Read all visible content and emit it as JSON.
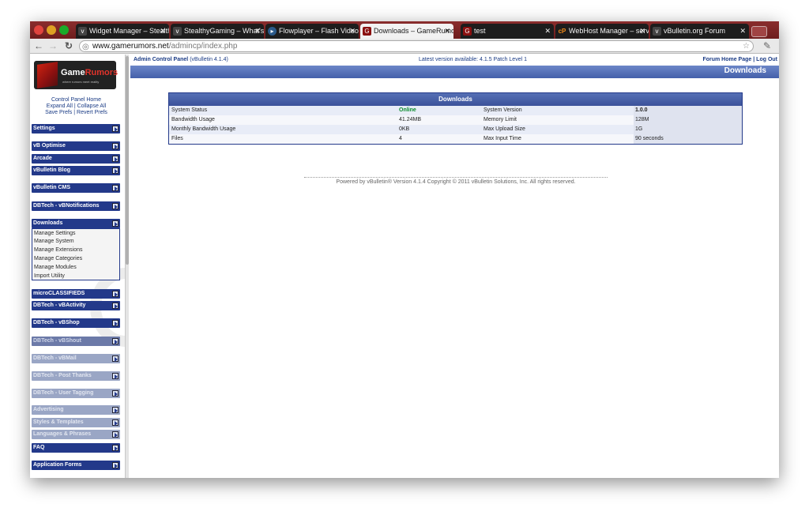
{
  "browser": {
    "tabs": [
      {
        "label": "Widget Manager – Stealth"
      },
      {
        "label": "StealthyGaming – What's"
      },
      {
        "label": "Flowplayer – Flash Video"
      },
      {
        "label": "Downloads – GameRumo"
      },
      {
        "label": "test"
      },
      {
        "label": "WebHost Manager – serv"
      },
      {
        "label": "vBulletin.org Forum"
      }
    ],
    "url_host": "www.gamerumors.net",
    "url_path": "/admincp/index.php"
  },
  "sidebar": {
    "logo_left": "Game",
    "logo_right": "Rumors",
    "logo_tagline": "where rumors meet reality",
    "cp_home": "Control Panel Home",
    "expand_all": "Expand All",
    "collapse_all": "Collapse All",
    "save_prefs": "Save Prefs",
    "revert_prefs": "Revert Prefs",
    "groups": [
      {
        "label": "Settings"
      },
      {
        "label": "vB Optimise"
      },
      {
        "label": "Arcade"
      },
      {
        "label": "vBulletin Blog"
      },
      {
        "label": "vBulletin CMS"
      },
      {
        "label": "DBTech - vBNotifications"
      },
      {
        "label": "Downloads"
      },
      {
        "label": "microCLASSIFIEDS"
      },
      {
        "label": "DBTech - vBActivity"
      },
      {
        "label": "DBTech - vBShop"
      },
      {
        "label": "DBTech - vBShout"
      },
      {
        "label": "DBTech - vBMail"
      },
      {
        "label": "DBTech - Post Thanks"
      },
      {
        "label": "DBTech - User Tagging"
      },
      {
        "label": "Advertising"
      },
      {
        "label": "Styles & Templates"
      },
      {
        "label": "Languages & Phrases"
      },
      {
        "label": "FAQ"
      },
      {
        "label": "Application Forms"
      }
    ],
    "downloads_items": [
      "Manage Settings",
      "Manage System",
      "Manage Extensions",
      "Manage Categories",
      "Manage Modules",
      "Import Utility"
    ]
  },
  "header": {
    "acp_label": "Admin Control Panel",
    "acp_version": "(vBulletin 4.1.4)",
    "latest_version": "Latest version available: 4.1.5 Patch Level 1",
    "forum_home": "Forum Home Page",
    "separator": "|",
    "log_out": "Log Out",
    "page_title": "Downloads"
  },
  "downloads_table": {
    "title": "Downloads",
    "rows": [
      {
        "k1": "System Status",
        "v1": "Online",
        "k2": "System Version",
        "v2": "1.0.0"
      },
      {
        "k1": "Bandwidth Usage",
        "v1": "41.24MB",
        "k2": "Memory Limit",
        "v2": "128M"
      },
      {
        "k1": "Monthly Bandwidth Usage",
        "v1": "0KB",
        "k2": "Max Upload Size",
        "v2": "1G"
      },
      {
        "k1": "Files",
        "v1": "4",
        "k2": "Max Input Time",
        "v2": "90 seconds"
      }
    ]
  },
  "footer": {
    "text": "Powered by vBulletin® Version 4.1.4 Copyright © 2011 vBulletin Solutions, Inc. All rights reserved."
  },
  "colors": {
    "nav_blue": "#23398a",
    "online_green": "#0a8c2c",
    "tabstrip_red": "#7a2424"
  }
}
